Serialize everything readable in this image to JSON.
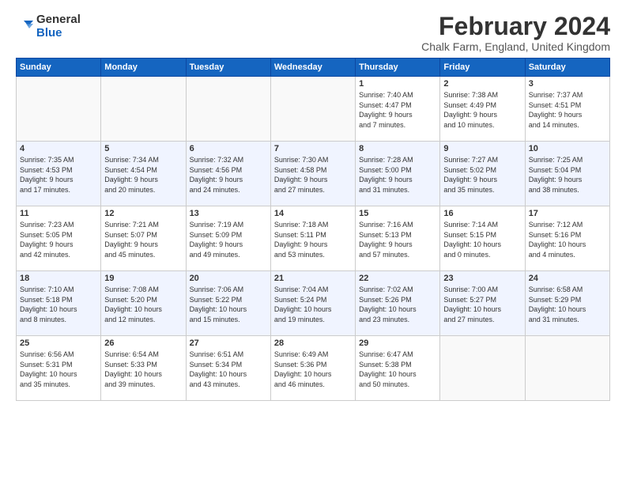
{
  "logo": {
    "line1": "General",
    "line2": "Blue"
  },
  "title": "February 2024",
  "location": "Chalk Farm, England, United Kingdom",
  "days_of_week": [
    "Sunday",
    "Monday",
    "Tuesday",
    "Wednesday",
    "Thursday",
    "Friday",
    "Saturday"
  ],
  "weeks": [
    {
      "striped": false,
      "days": [
        {
          "date": "",
          "info": ""
        },
        {
          "date": "",
          "info": ""
        },
        {
          "date": "",
          "info": ""
        },
        {
          "date": "",
          "info": ""
        },
        {
          "date": "1",
          "info": "Sunrise: 7:40 AM\nSunset: 4:47 PM\nDaylight: 9 hours\nand 7 minutes."
        },
        {
          "date": "2",
          "info": "Sunrise: 7:38 AM\nSunset: 4:49 PM\nDaylight: 9 hours\nand 10 minutes."
        },
        {
          "date": "3",
          "info": "Sunrise: 7:37 AM\nSunset: 4:51 PM\nDaylight: 9 hours\nand 14 minutes."
        }
      ]
    },
    {
      "striped": true,
      "days": [
        {
          "date": "4",
          "info": "Sunrise: 7:35 AM\nSunset: 4:53 PM\nDaylight: 9 hours\nand 17 minutes."
        },
        {
          "date": "5",
          "info": "Sunrise: 7:34 AM\nSunset: 4:54 PM\nDaylight: 9 hours\nand 20 minutes."
        },
        {
          "date": "6",
          "info": "Sunrise: 7:32 AM\nSunset: 4:56 PM\nDaylight: 9 hours\nand 24 minutes."
        },
        {
          "date": "7",
          "info": "Sunrise: 7:30 AM\nSunset: 4:58 PM\nDaylight: 9 hours\nand 27 minutes."
        },
        {
          "date": "8",
          "info": "Sunrise: 7:28 AM\nSunset: 5:00 PM\nDaylight: 9 hours\nand 31 minutes."
        },
        {
          "date": "9",
          "info": "Sunrise: 7:27 AM\nSunset: 5:02 PM\nDaylight: 9 hours\nand 35 minutes."
        },
        {
          "date": "10",
          "info": "Sunrise: 7:25 AM\nSunset: 5:04 PM\nDaylight: 9 hours\nand 38 minutes."
        }
      ]
    },
    {
      "striped": false,
      "days": [
        {
          "date": "11",
          "info": "Sunrise: 7:23 AM\nSunset: 5:05 PM\nDaylight: 9 hours\nand 42 minutes."
        },
        {
          "date": "12",
          "info": "Sunrise: 7:21 AM\nSunset: 5:07 PM\nDaylight: 9 hours\nand 45 minutes."
        },
        {
          "date": "13",
          "info": "Sunrise: 7:19 AM\nSunset: 5:09 PM\nDaylight: 9 hours\nand 49 minutes."
        },
        {
          "date": "14",
          "info": "Sunrise: 7:18 AM\nSunset: 5:11 PM\nDaylight: 9 hours\nand 53 minutes."
        },
        {
          "date": "15",
          "info": "Sunrise: 7:16 AM\nSunset: 5:13 PM\nDaylight: 9 hours\nand 57 minutes."
        },
        {
          "date": "16",
          "info": "Sunrise: 7:14 AM\nSunset: 5:15 PM\nDaylight: 10 hours\nand 0 minutes."
        },
        {
          "date": "17",
          "info": "Sunrise: 7:12 AM\nSunset: 5:16 PM\nDaylight: 10 hours\nand 4 minutes."
        }
      ]
    },
    {
      "striped": true,
      "days": [
        {
          "date": "18",
          "info": "Sunrise: 7:10 AM\nSunset: 5:18 PM\nDaylight: 10 hours\nand 8 minutes."
        },
        {
          "date": "19",
          "info": "Sunrise: 7:08 AM\nSunset: 5:20 PM\nDaylight: 10 hours\nand 12 minutes."
        },
        {
          "date": "20",
          "info": "Sunrise: 7:06 AM\nSunset: 5:22 PM\nDaylight: 10 hours\nand 15 minutes."
        },
        {
          "date": "21",
          "info": "Sunrise: 7:04 AM\nSunset: 5:24 PM\nDaylight: 10 hours\nand 19 minutes."
        },
        {
          "date": "22",
          "info": "Sunrise: 7:02 AM\nSunset: 5:26 PM\nDaylight: 10 hours\nand 23 minutes."
        },
        {
          "date": "23",
          "info": "Sunrise: 7:00 AM\nSunset: 5:27 PM\nDaylight: 10 hours\nand 27 minutes."
        },
        {
          "date": "24",
          "info": "Sunrise: 6:58 AM\nSunset: 5:29 PM\nDaylight: 10 hours\nand 31 minutes."
        }
      ]
    },
    {
      "striped": false,
      "days": [
        {
          "date": "25",
          "info": "Sunrise: 6:56 AM\nSunset: 5:31 PM\nDaylight: 10 hours\nand 35 minutes."
        },
        {
          "date": "26",
          "info": "Sunrise: 6:54 AM\nSunset: 5:33 PM\nDaylight: 10 hours\nand 39 minutes."
        },
        {
          "date": "27",
          "info": "Sunrise: 6:51 AM\nSunset: 5:34 PM\nDaylight: 10 hours\nand 43 minutes."
        },
        {
          "date": "28",
          "info": "Sunrise: 6:49 AM\nSunset: 5:36 PM\nDaylight: 10 hours\nand 46 minutes."
        },
        {
          "date": "29",
          "info": "Sunrise: 6:47 AM\nSunset: 5:38 PM\nDaylight: 10 hours\nand 50 minutes."
        },
        {
          "date": "",
          "info": ""
        },
        {
          "date": "",
          "info": ""
        }
      ]
    }
  ]
}
